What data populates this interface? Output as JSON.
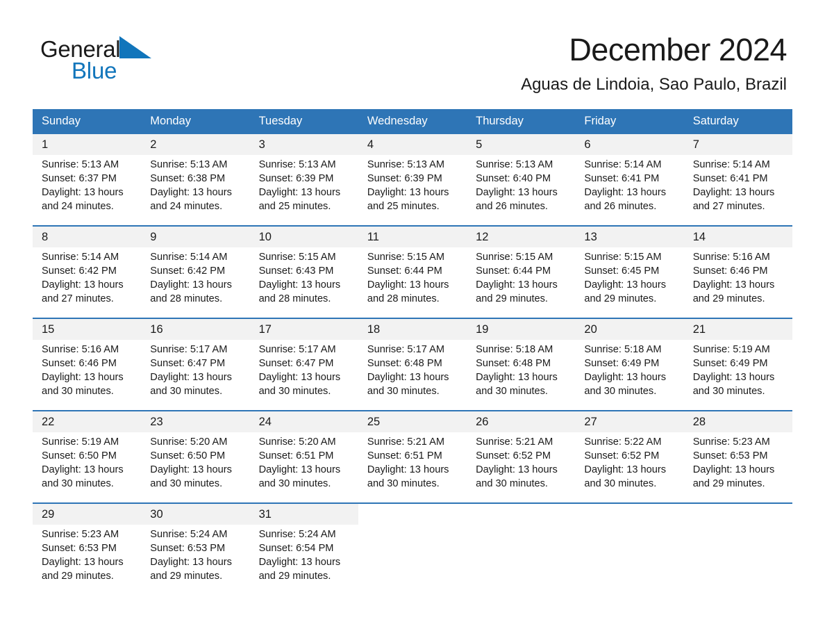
{
  "brand": {
    "name_part1": "General",
    "name_part2": "Blue",
    "accent_color": "#1175bb"
  },
  "header": {
    "title": "December 2024",
    "subtitle": "Aguas de Lindoia, Sao Paulo, Brazil"
  },
  "calendar": {
    "header_color": "#2e75b6",
    "daynum_bg": "#f2f2f2",
    "weekday_headers": [
      "Sunday",
      "Monday",
      "Tuesday",
      "Wednesday",
      "Thursday",
      "Friday",
      "Saturday"
    ],
    "weeks": [
      {
        "days": [
          {
            "num": "1",
            "sunrise": "Sunrise: 5:13 AM",
            "sunset": "Sunset: 6:37 PM",
            "daylight": "Daylight: 13 hours and 24 minutes."
          },
          {
            "num": "2",
            "sunrise": "Sunrise: 5:13 AM",
            "sunset": "Sunset: 6:38 PM",
            "daylight": "Daylight: 13 hours and 24 minutes."
          },
          {
            "num": "3",
            "sunrise": "Sunrise: 5:13 AM",
            "sunset": "Sunset: 6:39 PM",
            "daylight": "Daylight: 13 hours and 25 minutes."
          },
          {
            "num": "4",
            "sunrise": "Sunrise: 5:13 AM",
            "sunset": "Sunset: 6:39 PM",
            "daylight": "Daylight: 13 hours and 25 minutes."
          },
          {
            "num": "5",
            "sunrise": "Sunrise: 5:13 AM",
            "sunset": "Sunset: 6:40 PM",
            "daylight": "Daylight: 13 hours and 26 minutes."
          },
          {
            "num": "6",
            "sunrise": "Sunrise: 5:14 AM",
            "sunset": "Sunset: 6:41 PM",
            "daylight": "Daylight: 13 hours and 26 minutes."
          },
          {
            "num": "7",
            "sunrise": "Sunrise: 5:14 AM",
            "sunset": "Sunset: 6:41 PM",
            "daylight": "Daylight: 13 hours and 27 minutes."
          }
        ]
      },
      {
        "days": [
          {
            "num": "8",
            "sunrise": "Sunrise: 5:14 AM",
            "sunset": "Sunset: 6:42 PM",
            "daylight": "Daylight: 13 hours and 27 minutes."
          },
          {
            "num": "9",
            "sunrise": "Sunrise: 5:14 AM",
            "sunset": "Sunset: 6:42 PM",
            "daylight": "Daylight: 13 hours and 28 minutes."
          },
          {
            "num": "10",
            "sunrise": "Sunrise: 5:15 AM",
            "sunset": "Sunset: 6:43 PM",
            "daylight": "Daylight: 13 hours and 28 minutes."
          },
          {
            "num": "11",
            "sunrise": "Sunrise: 5:15 AM",
            "sunset": "Sunset: 6:44 PM",
            "daylight": "Daylight: 13 hours and 28 minutes."
          },
          {
            "num": "12",
            "sunrise": "Sunrise: 5:15 AM",
            "sunset": "Sunset: 6:44 PM",
            "daylight": "Daylight: 13 hours and 29 minutes."
          },
          {
            "num": "13",
            "sunrise": "Sunrise: 5:15 AM",
            "sunset": "Sunset: 6:45 PM",
            "daylight": "Daylight: 13 hours and 29 minutes."
          },
          {
            "num": "14",
            "sunrise": "Sunrise: 5:16 AM",
            "sunset": "Sunset: 6:46 PM",
            "daylight": "Daylight: 13 hours and 29 minutes."
          }
        ]
      },
      {
        "days": [
          {
            "num": "15",
            "sunrise": "Sunrise: 5:16 AM",
            "sunset": "Sunset: 6:46 PM",
            "daylight": "Daylight: 13 hours and 30 minutes."
          },
          {
            "num": "16",
            "sunrise": "Sunrise: 5:17 AM",
            "sunset": "Sunset: 6:47 PM",
            "daylight": "Daylight: 13 hours and 30 minutes."
          },
          {
            "num": "17",
            "sunrise": "Sunrise: 5:17 AM",
            "sunset": "Sunset: 6:47 PM",
            "daylight": "Daylight: 13 hours and 30 minutes."
          },
          {
            "num": "18",
            "sunrise": "Sunrise: 5:17 AM",
            "sunset": "Sunset: 6:48 PM",
            "daylight": "Daylight: 13 hours and 30 minutes."
          },
          {
            "num": "19",
            "sunrise": "Sunrise: 5:18 AM",
            "sunset": "Sunset: 6:48 PM",
            "daylight": "Daylight: 13 hours and 30 minutes."
          },
          {
            "num": "20",
            "sunrise": "Sunrise: 5:18 AM",
            "sunset": "Sunset: 6:49 PM",
            "daylight": "Daylight: 13 hours and 30 minutes."
          },
          {
            "num": "21",
            "sunrise": "Sunrise: 5:19 AM",
            "sunset": "Sunset: 6:49 PM",
            "daylight": "Daylight: 13 hours and 30 minutes."
          }
        ]
      },
      {
        "days": [
          {
            "num": "22",
            "sunrise": "Sunrise: 5:19 AM",
            "sunset": "Sunset: 6:50 PM",
            "daylight": "Daylight: 13 hours and 30 minutes."
          },
          {
            "num": "23",
            "sunrise": "Sunrise: 5:20 AM",
            "sunset": "Sunset: 6:50 PM",
            "daylight": "Daylight: 13 hours and 30 minutes."
          },
          {
            "num": "24",
            "sunrise": "Sunrise: 5:20 AM",
            "sunset": "Sunset: 6:51 PM",
            "daylight": "Daylight: 13 hours and 30 minutes."
          },
          {
            "num": "25",
            "sunrise": "Sunrise: 5:21 AM",
            "sunset": "Sunset: 6:51 PM",
            "daylight": "Daylight: 13 hours and 30 minutes."
          },
          {
            "num": "26",
            "sunrise": "Sunrise: 5:21 AM",
            "sunset": "Sunset: 6:52 PM",
            "daylight": "Daylight: 13 hours and 30 minutes."
          },
          {
            "num": "27",
            "sunrise": "Sunrise: 5:22 AM",
            "sunset": "Sunset: 6:52 PM",
            "daylight": "Daylight: 13 hours and 30 minutes."
          },
          {
            "num": "28",
            "sunrise": "Sunrise: 5:23 AM",
            "sunset": "Sunset: 6:53 PM",
            "daylight": "Daylight: 13 hours and 29 minutes."
          }
        ]
      },
      {
        "days": [
          {
            "num": "29",
            "sunrise": "Sunrise: 5:23 AM",
            "sunset": "Sunset: 6:53 PM",
            "daylight": "Daylight: 13 hours and 29 minutes."
          },
          {
            "num": "30",
            "sunrise": "Sunrise: 5:24 AM",
            "sunset": "Sunset: 6:53 PM",
            "daylight": "Daylight: 13 hours and 29 minutes."
          },
          {
            "num": "31",
            "sunrise": "Sunrise: 5:24 AM",
            "sunset": "Sunset: 6:54 PM",
            "daylight": "Daylight: 13 hours and 29 minutes."
          },
          {
            "num": "",
            "sunrise": "",
            "sunset": "",
            "daylight": ""
          },
          {
            "num": "",
            "sunrise": "",
            "sunset": "",
            "daylight": ""
          },
          {
            "num": "",
            "sunrise": "",
            "sunset": "",
            "daylight": ""
          },
          {
            "num": "",
            "sunrise": "",
            "sunset": "",
            "daylight": ""
          }
        ]
      }
    ]
  }
}
